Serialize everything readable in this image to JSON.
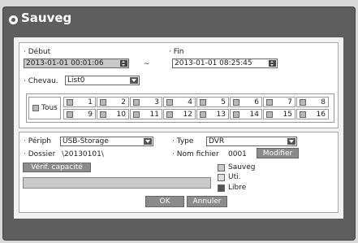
{
  "window": {
    "title": "Sauveg"
  },
  "debut": {
    "label": "· Début",
    "value": "2013-01-01 00:01:06"
  },
  "separator": "~",
  "fin": {
    "label": "· Fin",
    "value": "2013-01-01 08:25:45"
  },
  "cheval": {
    "label": "· Chevau.",
    "value": "List0"
  },
  "channels": {
    "all_label": "Tous",
    "items": [
      "1",
      "2",
      "3",
      "4",
      "5",
      "6",
      "7",
      "8",
      "9",
      "10",
      "11",
      "12",
      "13",
      "14",
      "15",
      "16"
    ]
  },
  "periph": {
    "label": "· Périph",
    "value": "USB-Storage"
  },
  "type": {
    "label": "· Type",
    "value": "DVR"
  },
  "dossier": {
    "label": "· Dossier",
    "value": "\\20130101\\"
  },
  "nom_fichier": {
    "label": "· Nom fichier",
    "value": "0001"
  },
  "buttons": {
    "modifier": "Modifier",
    "verif": "Vérif. capacité",
    "ok": "OK",
    "annuler": "Annuler"
  },
  "legend": [
    {
      "label": "Sauveg",
      "color": "#c9c9c9"
    },
    {
      "label": "Uti.",
      "color": "#e0e0e0"
    },
    {
      "label": "Libre",
      "color": "#555555"
    }
  ]
}
